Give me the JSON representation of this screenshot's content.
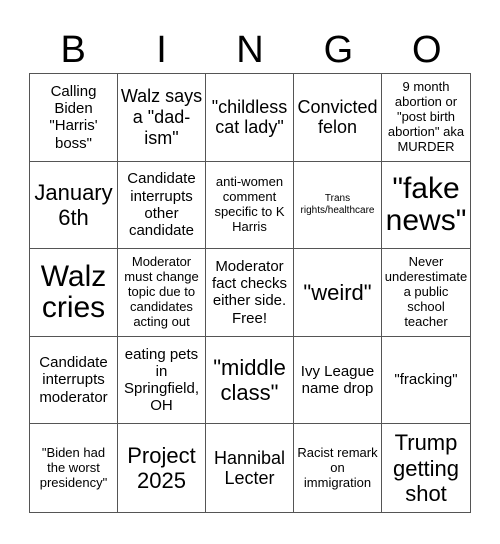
{
  "header": [
    "B",
    "I",
    "N",
    "G",
    "O"
  ],
  "cells": [
    [
      "Calling Biden \"Harris' boss\"",
      "Walz says a \"dad-ism\"",
      "\"childless cat lady\"",
      "Convicted felon",
      "9 month abortion or \"post birth abortion\" aka MURDER"
    ],
    [
      "January 6th",
      "Candidate interrupts other candidate",
      "anti-women comment specific to K Harris",
      "Trans rights/healthcare",
      "\"fake news\""
    ],
    [
      "Walz cries",
      "Moderator must change topic due to candidates acting out",
      "Moderator fact checks either side. Free!",
      "\"weird\"",
      "Never underestimate a public school teacher"
    ],
    [
      "Candidate interrupts moderator",
      "eating pets in Springfield, OH",
      "\"middle class\"",
      "Ivy League name drop",
      "\"fracking\""
    ],
    [
      "\"Biden had the worst presidency\"",
      "Project 2025",
      "Hannibal Lecter",
      "Racist remark on immigration",
      "Trump getting shot"
    ]
  ]
}
